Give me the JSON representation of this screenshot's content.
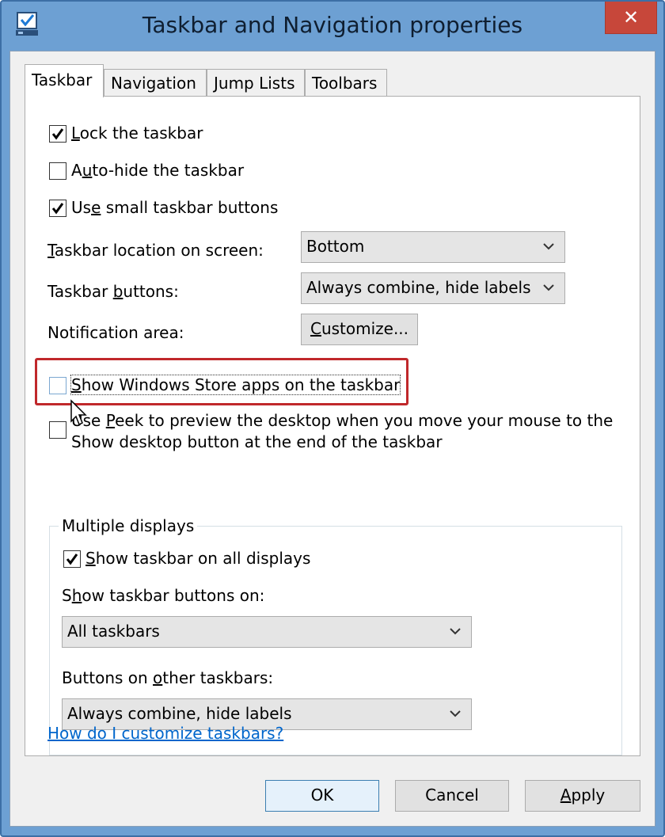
{
  "window": {
    "title": "Taskbar and Navigation properties",
    "close_label": "✕"
  },
  "tabs": [
    {
      "label": "Taskbar",
      "active": true
    },
    {
      "label": "Navigation",
      "active": false
    },
    {
      "label": "Jump Lists",
      "active": false
    },
    {
      "label": "Toolbars",
      "active": false
    }
  ],
  "taskbar": {
    "lock": {
      "label_pre": "",
      "label_u": "L",
      "label_post": "ock the taskbar",
      "checked": true
    },
    "autohide": {
      "label_pre": "A",
      "label_u": "u",
      "label_post": "to-hide the taskbar",
      "checked": false
    },
    "small_buttons": {
      "label_pre": "Us",
      "label_u": "e",
      "label_post": " small taskbar buttons",
      "checked": true
    },
    "location": {
      "label_pre": "",
      "label_u": "T",
      "label_post": "askbar location on screen:",
      "value": "Bottom"
    },
    "buttons": {
      "label_pre": "Taskbar ",
      "label_u": "b",
      "label_post": "uttons:",
      "value": "Always combine, hide labels"
    },
    "notification": {
      "label": "Notification area:",
      "button_u": "C",
      "button_post": "ustomize..."
    },
    "store_apps": {
      "label_pre": "",
      "label_u": "S",
      "label_post": "how Windows Store apps on the taskbar",
      "checked": false
    },
    "peek": {
      "line1_pre": "Use ",
      "line1_u": "P",
      "line1_post": "eek to preview the desktop when you move your mouse to the",
      "line2": "Show desktop button at the end of the taskbar",
      "checked": false
    }
  },
  "multiple_displays": {
    "title": "Multiple displays",
    "show_all": {
      "label_pre": "",
      "label_u": "S",
      "label_post": "how taskbar on all displays",
      "checked": true
    },
    "show_on_label_pre": "S",
    "show_on_label_u": "h",
    "show_on_label_post": "ow taskbar buttons on:",
    "show_on_value": "All taskbars",
    "other_label_pre": "Buttons on ",
    "other_label_u": "o",
    "other_label_post": "ther taskbars:",
    "other_value": "Always combine, hide labels"
  },
  "help_link": "How do I customize taskbars?",
  "buttons": {
    "ok": "OK",
    "cancel": "Cancel",
    "apply_u": "A",
    "apply_post": "pply"
  },
  "colors": {
    "title_bar": "#6da0d3",
    "close_button": "#c7473a",
    "annotation": "#c0282b",
    "link": "#0066cc"
  }
}
